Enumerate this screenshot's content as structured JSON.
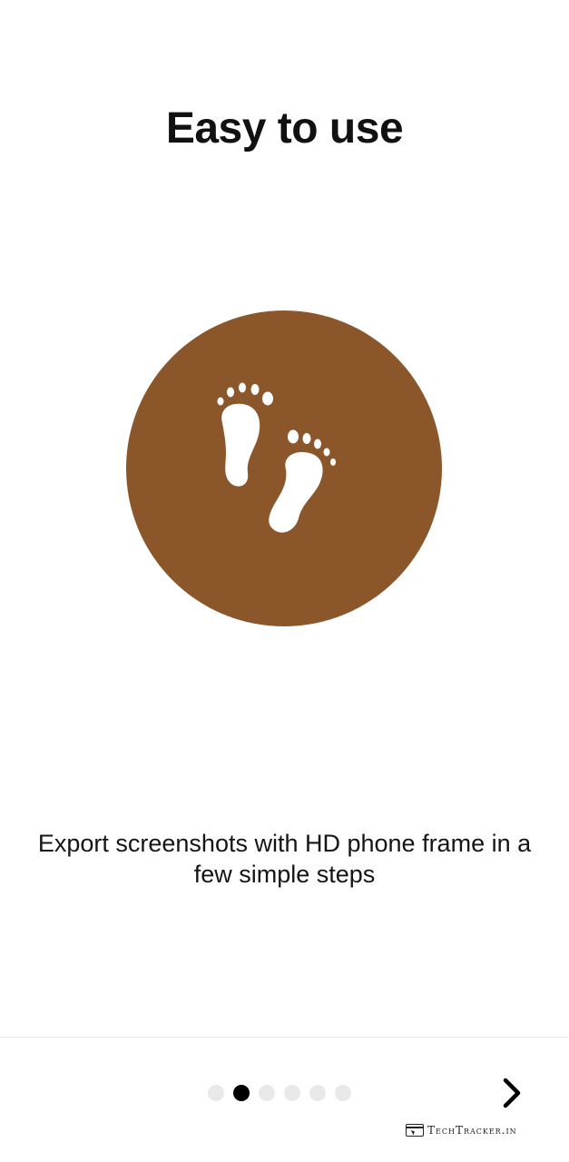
{
  "onboarding": {
    "title": "Easy to use",
    "hero_icon": "footprints-icon",
    "description": "Export screenshots with HD phone frame in a few simple steps",
    "colors": {
      "hero_circle": "#8B572A",
      "icon": "#FFFFFF"
    }
  },
  "pager": {
    "total_pages": 6,
    "current_page": 2,
    "dot_names": [
      "page-dot-1",
      "page-dot-2",
      "page-dot-3",
      "page-dot-4",
      "page-dot-5",
      "page-dot-6"
    ]
  },
  "navigation": {
    "next_icon": "chevron-right-icon"
  },
  "watermark": {
    "logo_icon": "browser-cursor-icon",
    "text": "TechTracker.in"
  }
}
